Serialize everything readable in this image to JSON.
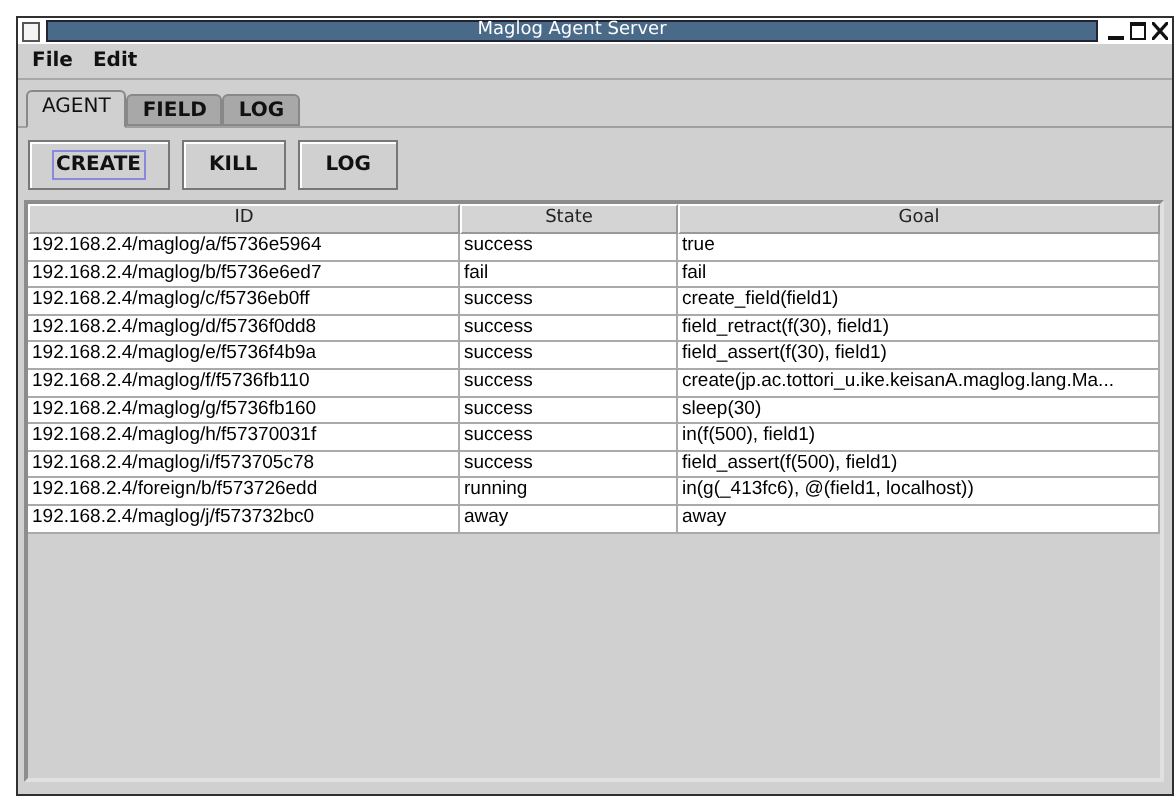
{
  "window": {
    "title": "Maglog Agent Server"
  },
  "menu": [
    "File",
    "Edit"
  ],
  "tabs": [
    {
      "label": "AGENT",
      "selected": true
    },
    {
      "label": "FIELD",
      "selected": false
    },
    {
      "label": "LOG",
      "selected": false
    }
  ],
  "buttons": [
    {
      "label": "CREATE",
      "focused": true
    },
    {
      "label": "KILL",
      "focused": false
    },
    {
      "label": "LOG",
      "focused": false
    }
  ],
  "table": {
    "columns": [
      "ID",
      "State",
      "Goal"
    ],
    "rows": [
      [
        "192.168.2.4/maglog/a/f5736e5964",
        "success",
        "true"
      ],
      [
        "192.168.2.4/maglog/b/f5736e6ed7",
        "fail",
        "fail"
      ],
      [
        "192.168.2.4/maglog/c/f5736eb0ff",
        "success",
        "create_field(field1)"
      ],
      [
        "192.168.2.4/maglog/d/f5736f0dd8",
        "success",
        "field_retract(f(30), field1)"
      ],
      [
        "192.168.2.4/maglog/e/f5736f4b9a",
        "success",
        "field_assert(f(30), field1)"
      ],
      [
        "192.168.2.4/maglog/f/f5736fb110",
        "success",
        "create(jp.ac.tottori_u.ike.keisanA.maglog.lang.Ma..."
      ],
      [
        "192.168.2.4/maglog/g/f5736fb160",
        "success",
        "sleep(30)"
      ],
      [
        "192.168.2.4/maglog/h/f57370031f",
        "success",
        "in(f(500), field1)"
      ],
      [
        "192.168.2.4/maglog/i/f573705c78",
        "success",
        "field_assert(f(500), field1)"
      ],
      [
        "192.168.2.4/foreign/b/f573726edd",
        "running",
        "in(g(_413fc6), @(field1, localhost))"
      ],
      [
        "192.168.2.4/maglog/j/f573732bc0",
        "away",
        "away"
      ]
    ]
  }
}
